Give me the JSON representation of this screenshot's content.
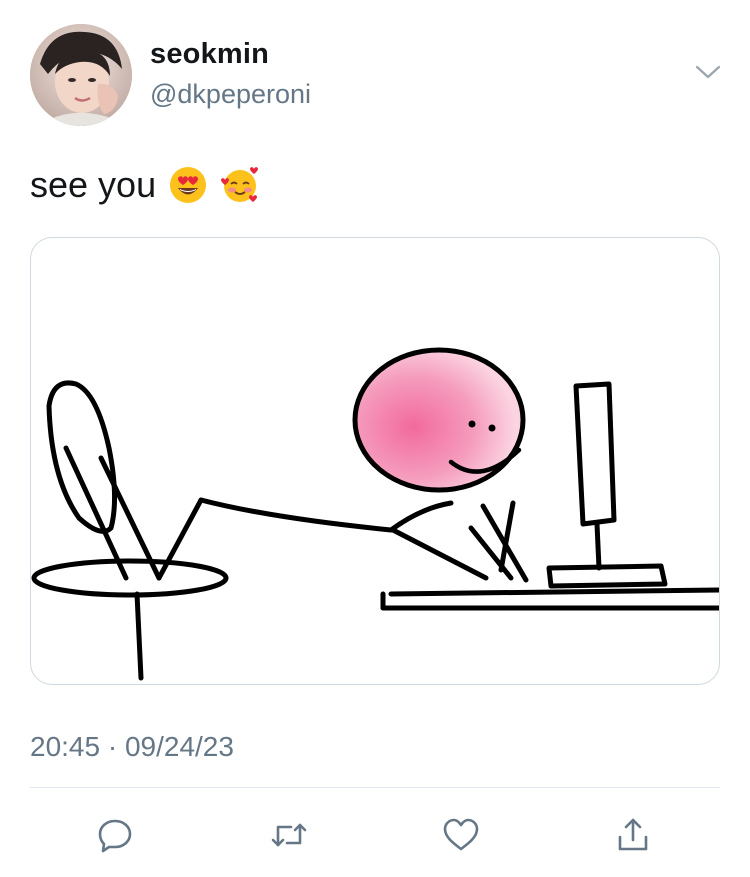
{
  "user": {
    "display_name": "seokmin",
    "handle": "@dkpeperoni"
  },
  "tweet": {
    "text": "see you",
    "emojis": [
      "heart-eyes-face",
      "smiling-face-with-hearts"
    ],
    "timestamp": "20:45 · 09/24/23"
  },
  "media": {
    "description_icon": "stick-figure-at-computer-drawing"
  },
  "actions": [
    "reply-icon",
    "retweet-icon",
    "like-icon",
    "share-icon"
  ],
  "colors": {
    "text": "#14171a",
    "secondary": "#657786",
    "border": "#cfd9de",
    "blush": "#f07aa0"
  }
}
